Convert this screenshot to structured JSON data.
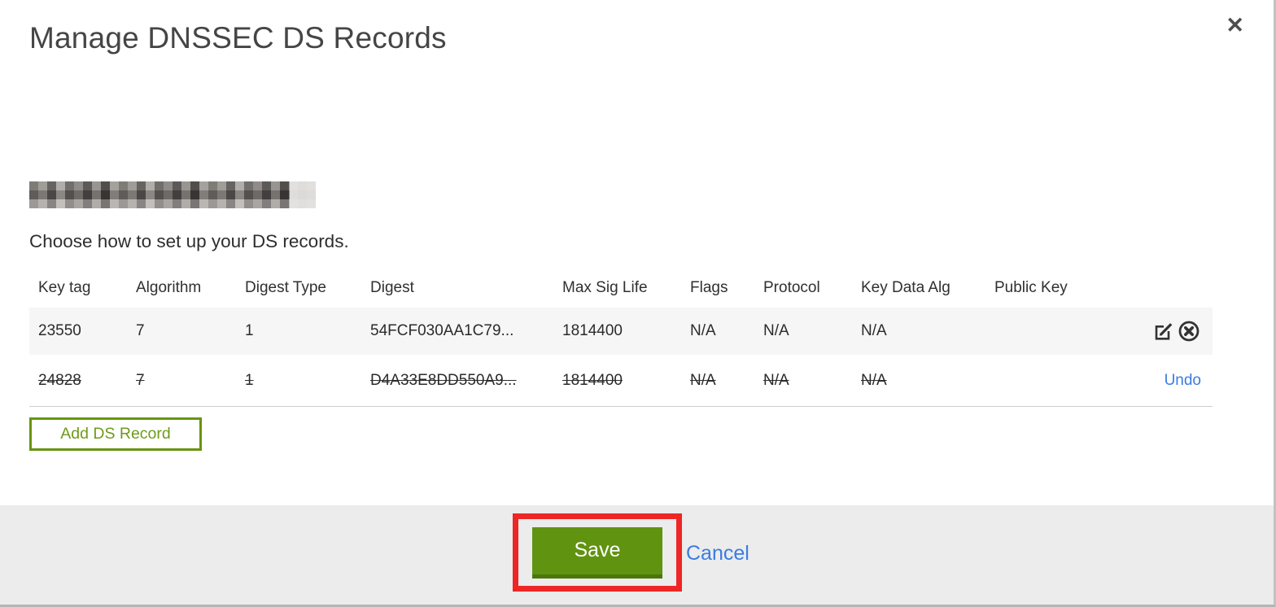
{
  "modal": {
    "title": "Manage DNSSEC DS Records",
    "close_icon": "✕"
  },
  "instruction": "Choose how to set up your DS records.",
  "table": {
    "headers": [
      "Key tag",
      "Algorithm",
      "Digest Type",
      "Digest",
      "Max Sig Life",
      "Flags",
      "Protocol",
      "Key Data Alg",
      "Public Key"
    ],
    "rows": [
      {
        "key_tag": "23550",
        "algorithm": "7",
        "digest_type": "1",
        "digest": "54FCF030AA1C79...",
        "max_sig_life": "1814400",
        "flags": "N/A",
        "protocol": "N/A",
        "key_data_alg": "N/A",
        "public_key": "",
        "status": "active"
      },
      {
        "key_tag": "24828",
        "algorithm": "7",
        "digest_type": "1",
        "digest": "D4A33E8DD550A9...",
        "max_sig_life": "1814400",
        "flags": "N/A",
        "protocol": "N/A",
        "key_data_alg": "N/A",
        "public_key": "",
        "status": "deleted",
        "undo_label": "Undo"
      }
    ],
    "row_icons": [
      "edit-icon",
      "delete-icon"
    ]
  },
  "buttons": {
    "add_ds_record": "Add DS Record",
    "save": "Save",
    "cancel": "Cancel"
  },
  "colors": {
    "accent_green": "#609310",
    "accent_green_dark": "#4c760c",
    "annotation_red": "#ee2626",
    "link_blue": "#3b7ce0",
    "footer_gray": "#ececec",
    "row_stripe": "#f6f6f6"
  }
}
